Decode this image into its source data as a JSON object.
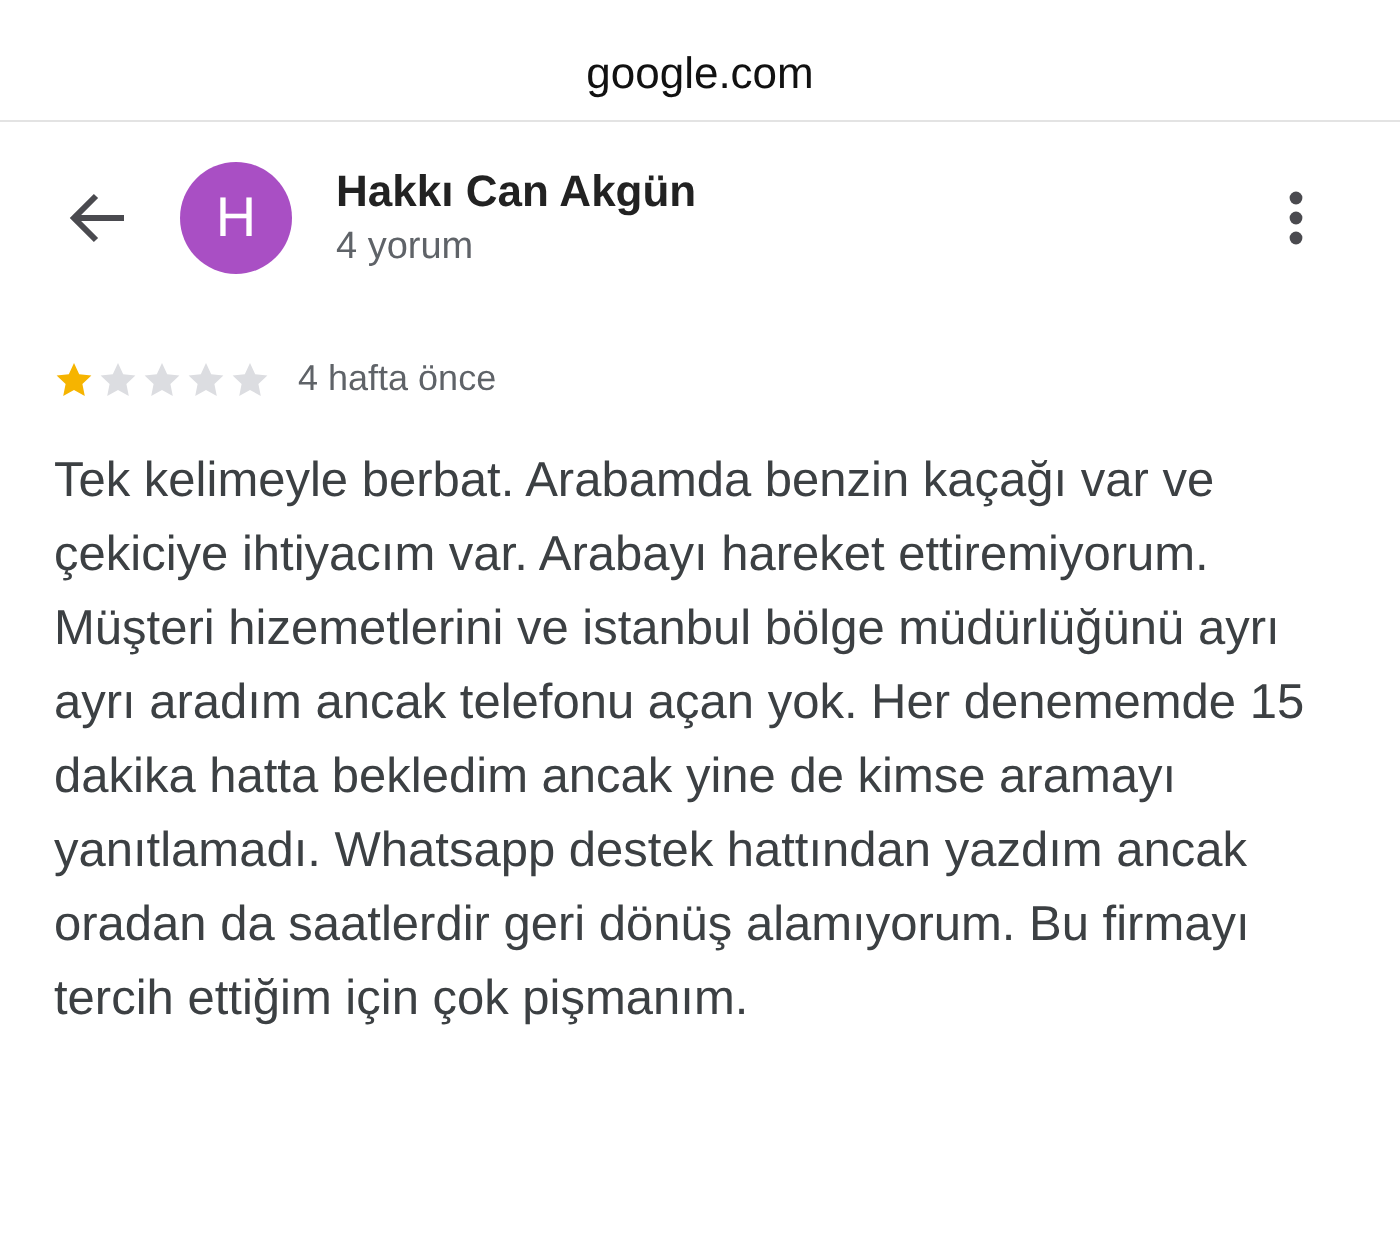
{
  "address_bar": {
    "url": "google.com"
  },
  "reviewer": {
    "initial": "H",
    "name": "Hakkı Can Akgün",
    "review_count": "4 yorum"
  },
  "review": {
    "stars": 1,
    "time": "4 hafta önce",
    "text": "Tek kelimeyle berbat. Arabamda benzin kaçağı var ve çekiciye ihtiyacım var. Arabayı hareket ettiremiyorum. Müşteri hizemetlerini ve istanbul bölge müdürlüğünü ayrı ayrı aradım ancak telefonu açan yok. Her denememde 15 dakika hatta bekledim ancak yine de kimse aramayı yanıtlamadı. Whatsapp destek hattından yazdım ancak oradan da saatlerdir geri dönüş alamıyorum. Bu firmayı tercih ettiğim için çok pişmanım."
  }
}
